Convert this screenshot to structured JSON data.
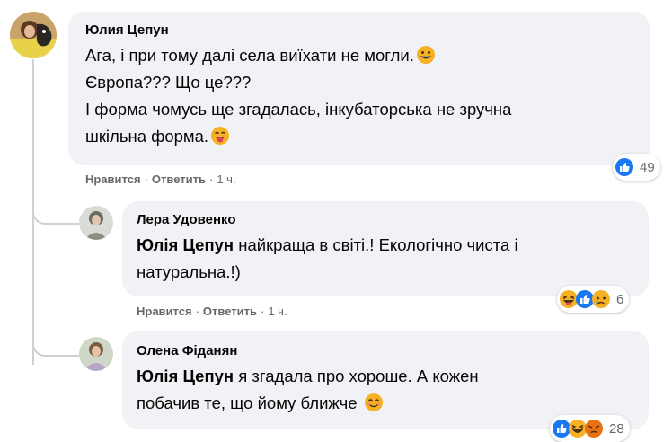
{
  "comments": [
    {
      "author": "Юлия Цепун",
      "lines": [
        {
          "text": "Ага, і при тому далі села виїхати не могли.",
          "emoji": "grinning-face-icon"
        },
        {
          "text": "Європа??? Що це???"
        },
        {
          "text": "І форма чомусь ще згадалась, інкубаторська не зручна"
        },
        {
          "text": "шкільна форма.",
          "emoji": "tongue-face-icon"
        }
      ],
      "actions": {
        "like": "Нравится",
        "reply": "Ответить",
        "time": "1 ч."
      },
      "reactions": {
        "icons": [
          "like-reaction-icon"
        ],
        "count": "49"
      }
    },
    {
      "author": "Лера Удовенко",
      "mention": "Юлія Цепун",
      "line1_rest": " найкраща в світі.! Екологічно чиста і",
      "line2": "натуральна.!)",
      "actions": {
        "like": "Нравится",
        "reply": "Ответить",
        "time": "1 ч."
      },
      "reactions": {
        "icons": [
          "haha-reaction-icon",
          "like-reaction-icon",
          "sad-reaction-icon"
        ],
        "count": "6"
      }
    },
    {
      "author": "Олена Фіданян",
      "mention": "Юлія Цепун",
      "line1_rest": " я згадала про хороше. А кожен",
      "line2": "побачив те, що йому ближче",
      "line2_emoji": "smiling-face-icon",
      "reactions": {
        "icons": [
          "like-reaction-icon",
          "haha-reaction-icon",
          "angry-reaction-icon"
        ],
        "count": "28"
      }
    }
  ],
  "colors": {
    "bubble": "#f0f2f5",
    "meta": "#65676b",
    "like_blue": "#1877f2",
    "reaction_yellow": "#f7b125"
  }
}
